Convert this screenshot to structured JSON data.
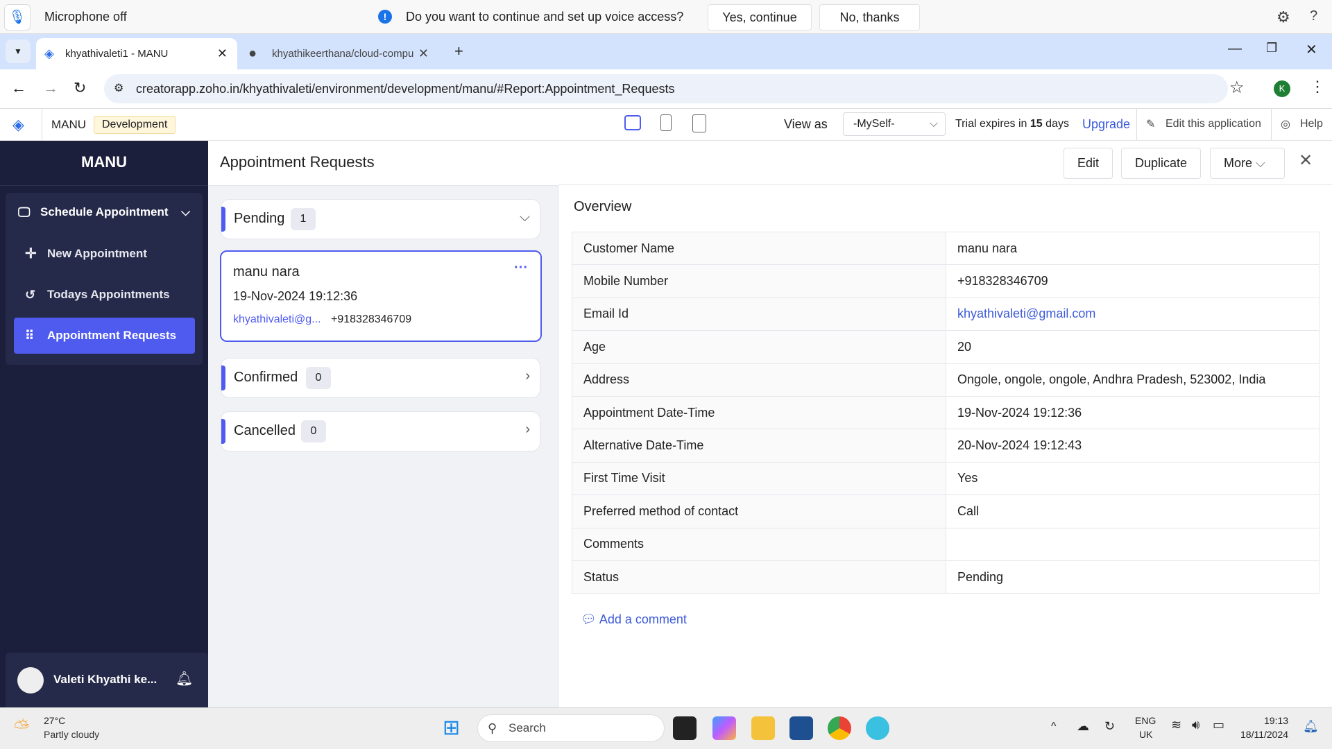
{
  "voice_prompt": {
    "status": "Microphone off",
    "question": "Do you want to continue and set up voice access?",
    "yes": "Yes, continue",
    "no": "No, thanks"
  },
  "browser": {
    "tabs": [
      {
        "title": "khyathivaleti1 -  MANU"
      },
      {
        "title": "khyathikeerthana/cloud-compu"
      }
    ],
    "url": "creatorapp.zoho.in/khyathivaleti/environment/development/manu/#Report:Appointment_Requests",
    "profile": "K"
  },
  "app_header": {
    "app_name": "MANU",
    "env_badge": "Development",
    "view_as_label": "View as",
    "view_as_value": "-MySelf-",
    "trial_prefix": "Trial expires in",
    "trial_days": "15",
    "trial_suffix": "days",
    "upgrade": "Upgrade",
    "edit_app": "Edit this application",
    "help": "Help"
  },
  "sidebar": {
    "title": "MANU",
    "section": "Schedule Appointment",
    "items": [
      {
        "label": "New Appointment",
        "icon": "plus-icon"
      },
      {
        "label": "Todays Appointments",
        "icon": "history-icon"
      },
      {
        "label": "Appointment Requests",
        "icon": "grid-icon",
        "active": true
      }
    ],
    "user": "Valeti Khyathi ke..."
  },
  "list": {
    "title": "Appointment Requests",
    "groups": [
      {
        "label": "Pending",
        "count": "1"
      },
      {
        "label": "Confirmed",
        "count": "0"
      },
      {
        "label": "Cancelled",
        "count": "0"
      }
    ],
    "card": {
      "name": "manu nara",
      "datetime": "19-Nov-2024 19:12:36",
      "email": "khyathivaleti@g...",
      "phone": "+918328346709"
    }
  },
  "detail": {
    "buttons": {
      "edit": "Edit",
      "duplicate": "Duplicate",
      "more": "More"
    },
    "section": "Overview",
    "rows": [
      {
        "label": "Customer Name",
        "value": "manu nara"
      },
      {
        "label": "Mobile Number",
        "value": "+918328346709"
      },
      {
        "label": "Email Id",
        "value": "khyathivaleti@gmail.com"
      },
      {
        "label": "Age",
        "value": "20"
      },
      {
        "label": "Address",
        "value": "Ongole, ongole, ongole, Andhra Pradesh, 523002, India"
      },
      {
        "label": "Appointment Date-Time",
        "value": "19-Nov-2024 19:12:36"
      },
      {
        "label": "Alternative Date-Time",
        "value": "20-Nov-2024 19:12:43"
      },
      {
        "label": "First Time Visit",
        "value": "Yes"
      },
      {
        "label": "Preferred method of contact",
        "value": "Call"
      },
      {
        "label": "Comments",
        "value": ""
      },
      {
        "label": "Status",
        "value": "Pending"
      }
    ],
    "add_comment": "Add a comment"
  },
  "taskbar": {
    "temp": "27°C",
    "weather": "Partly cloudy",
    "search": "Search",
    "lang1": "ENG",
    "lang2": "UK",
    "time": "19:13",
    "date": "18/11/2024"
  },
  "colors": {
    "accent": "#4f5bef",
    "sidebar": "#1c1f3b",
    "link": "#3c5bd9"
  }
}
